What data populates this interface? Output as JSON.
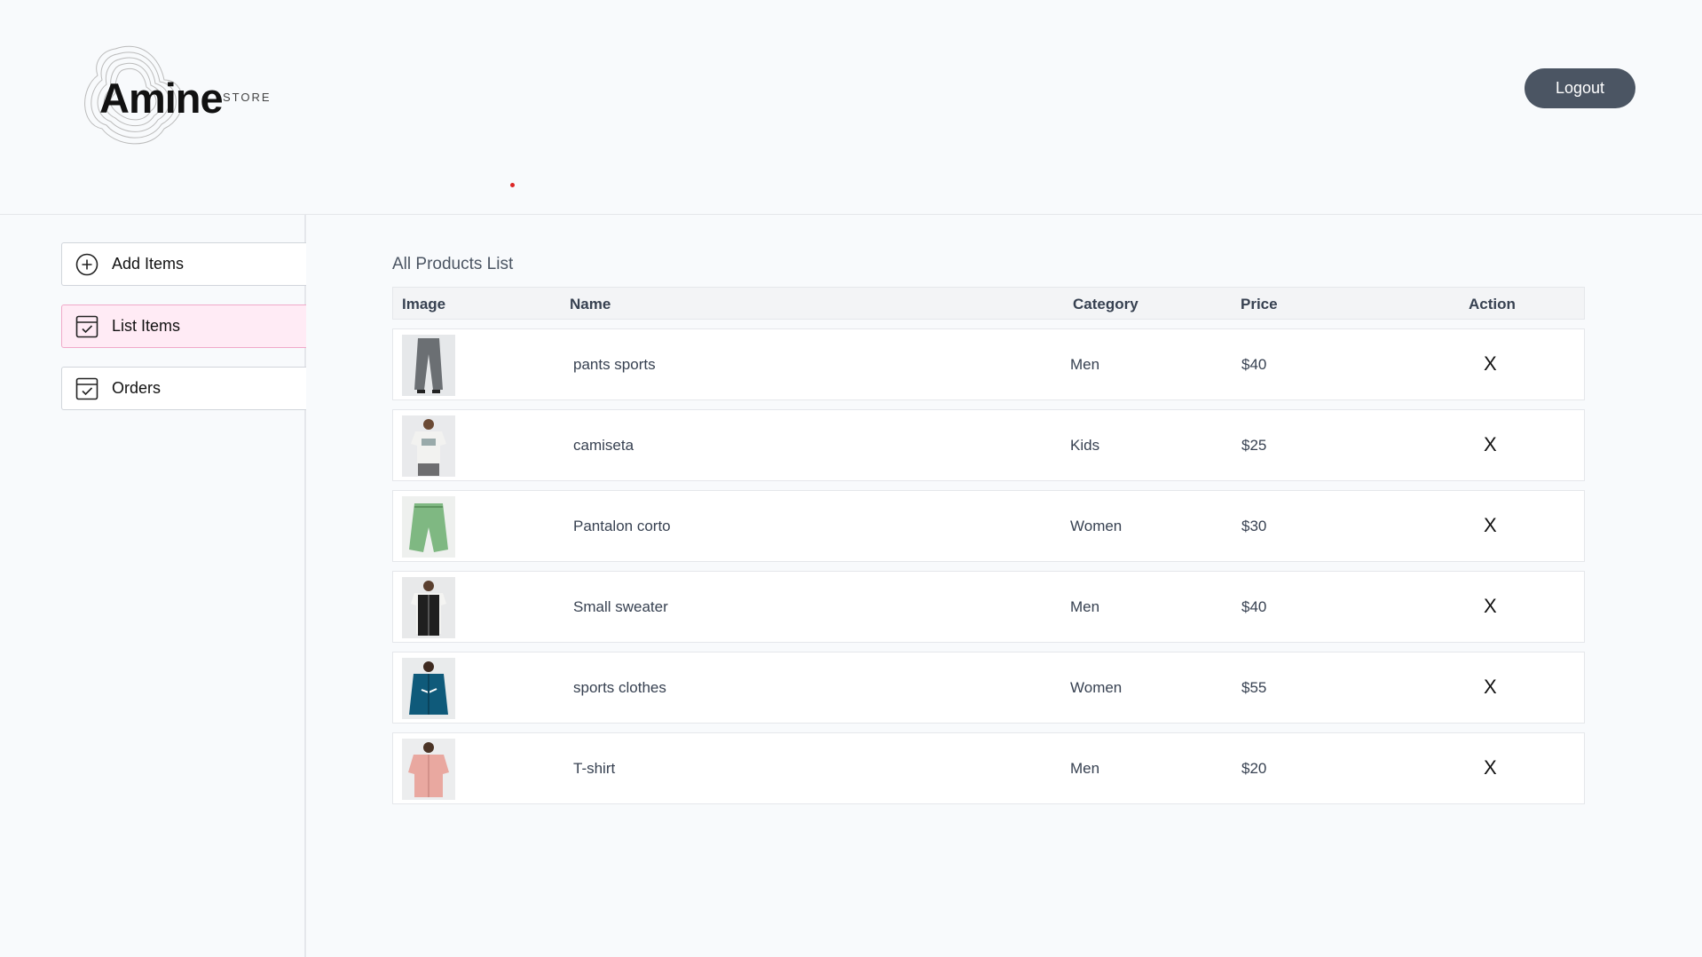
{
  "header": {
    "logo_word": "Amine",
    "logo_sub": "STORE",
    "logout_label": "Logout"
  },
  "sidebar": {
    "items": [
      {
        "label": "Add Items",
        "icon": "plus-circle-icon",
        "active": false
      },
      {
        "label": "List Items",
        "icon": "checkbox-icon",
        "active": true
      },
      {
        "label": "Orders",
        "icon": "checkbox-icon",
        "active": false
      }
    ]
  },
  "main": {
    "title": "All Products List",
    "columns": [
      "Image",
      "Name",
      "Category",
      "Price",
      "Action"
    ],
    "remove_symbol": "X",
    "products": [
      {
        "name": "pants sports",
        "category": "Men",
        "price": "$40",
        "image": "grey-pants"
      },
      {
        "name": "camiseta",
        "category": "Kids",
        "price": "$25",
        "image": "white-tshirt"
      },
      {
        "name": "Pantalon corto",
        "category": "Women",
        "price": "$30",
        "image": "green-shorts"
      },
      {
        "name": "Small sweater",
        "category": "Men",
        "price": "$40",
        "image": "black-vest"
      },
      {
        "name": "sports clothes",
        "category": "Women",
        "price": "$55",
        "image": "blue-jacket"
      },
      {
        "name": "T-shirt",
        "category": "Men",
        "price": "$20",
        "image": "pink-shirt"
      }
    ]
  },
  "colors": {
    "background": "#f8fafc",
    "logout_bg": "#4b5563",
    "active_nav_bg": "#ffebf5",
    "active_nav_border": "#f0a9c9",
    "accent_dot": "#dc2626"
  }
}
